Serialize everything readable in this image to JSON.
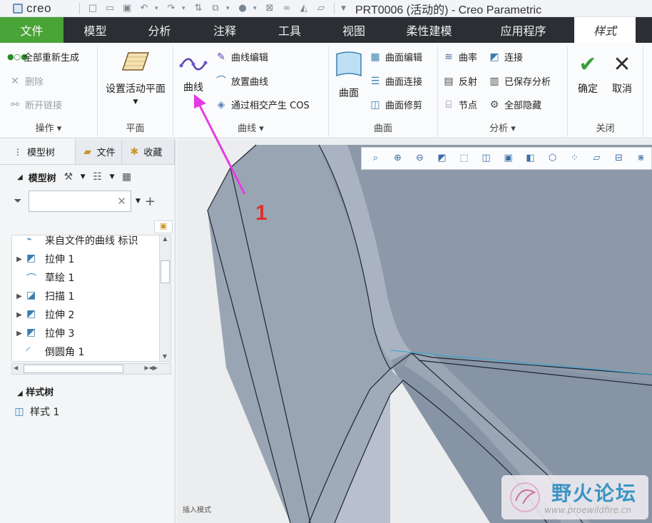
{
  "titlebar": {
    "logo": "creo",
    "title": "PRT0006 (活动的) - Creo Parametric"
  },
  "tabs": [
    "文件",
    "模型",
    "分析",
    "注释",
    "工具",
    "视图",
    "柔性建模",
    "应用程序",
    "样式"
  ],
  "ribbon": {
    "operations": {
      "label": "操作",
      "regen": "全部重新生成",
      "delete": "删除",
      "break_link": "断开链接"
    },
    "plane": {
      "label": "平面",
      "set_active_plane": "设置活动平面"
    },
    "curves": {
      "label": "曲线",
      "curve": "曲线",
      "curve_edit": "曲线编辑",
      "place_curve": "放置曲线",
      "cos": "通过相交产生 COS"
    },
    "surface": {
      "label": "曲面",
      "surface": "曲面",
      "surface_edit": "曲面编辑",
      "surface_connect": "曲面连接",
      "surface_trim": "曲面修剪"
    },
    "analysis": {
      "label": "分析",
      "curvature": "曲率",
      "connect": "连接",
      "reflection": "反射",
      "saved_analysis": "已保存分析",
      "node": "节点",
      "hide_all": "全部隐藏"
    },
    "close": {
      "label": "关闭",
      "ok": "确定",
      "cancel": "取消"
    }
  },
  "left_panel": {
    "tabs": [
      "模型树",
      "文件",
      "收藏"
    ],
    "tree_title": "模型树",
    "tree_items": [
      "来自文件的曲线 标识",
      "拉伸 1",
      "草绘 1",
      "扫描 1",
      "拉伸 2",
      "拉伸 3",
      "倒圆角 1"
    ],
    "style_tree_title": "样式树",
    "style_item": "样式 1",
    "status": "插入模式"
  },
  "annotation": "1",
  "watermark": {
    "name": "野火论坛",
    "url": "www.proewildfire.cn"
  },
  "colors": {
    "file_tab": "#4aa336",
    "tab_bar": "#2b2f33",
    "annotation_arrow": "#e63be3",
    "annotation_number": "#e0302b",
    "model": "#8d98a8"
  }
}
